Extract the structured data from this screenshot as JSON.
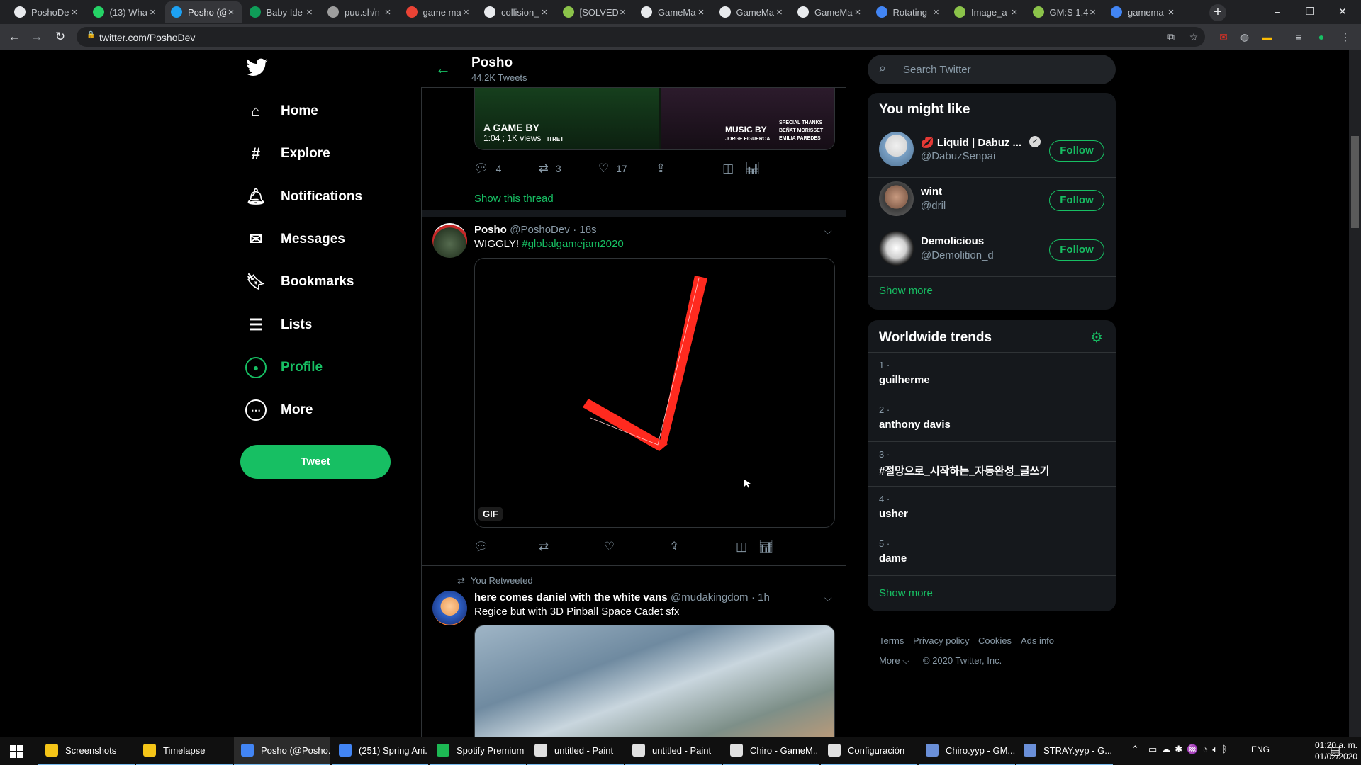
{
  "browser": {
    "tabs": [
      {
        "title": "PoshoDe",
        "favicon_color": "#e8eaed"
      },
      {
        "title": "(13) Wha",
        "favicon_color": "#25d366"
      },
      {
        "title": "Posho (@",
        "favicon_color": "#1da1f2"
      },
      {
        "title": "Baby Ide",
        "favicon_color": "#0f9d58"
      },
      {
        "title": "puu.sh/n",
        "favicon_color": "#9e9e9e"
      },
      {
        "title": "game ma",
        "favicon_color": "#ea4335"
      },
      {
        "title": "collision_",
        "favicon_color": "#e8eaed"
      },
      {
        "title": "[SOLVED",
        "favicon_color": "#8bc34a"
      },
      {
        "title": "GameMa",
        "favicon_color": "#e8eaed"
      },
      {
        "title": "GameMa",
        "favicon_color": "#e8eaed"
      },
      {
        "title": "GameMa",
        "favicon_color": "#e8eaed"
      },
      {
        "title": "Rotating",
        "favicon_color": "#4285f4"
      },
      {
        "title": "Image_a",
        "favicon_color": "#8bc34a"
      },
      {
        "title": "GM:S 1.4",
        "favicon_color": "#8bc34a"
      },
      {
        "title": "gamema",
        "favicon_color": "#4285f4"
      }
    ],
    "active_tab_index": 2,
    "url": "twitter.com/PoshoDev",
    "window_controls": {
      "minimize": "–",
      "restore": "❐",
      "close": "✕"
    }
  },
  "nav": {
    "items": [
      {
        "label": "Home",
        "icon": "home-icon"
      },
      {
        "label": "Explore",
        "icon": "hashtag-icon"
      },
      {
        "label": "Notifications",
        "icon": "bell-icon"
      },
      {
        "label": "Messages",
        "icon": "envelope-icon"
      },
      {
        "label": "Bookmarks",
        "icon": "bookmark-icon"
      },
      {
        "label": "Lists",
        "icon": "list-icon"
      },
      {
        "label": "Profile",
        "icon": "avatar-icon"
      },
      {
        "label": "More",
        "icon": "more-icon"
      }
    ],
    "active": "Profile",
    "tweet_button": "Tweet"
  },
  "header": {
    "name": "Posho",
    "tweet_count": "44.2K Tweets"
  },
  "previous_tweet": {
    "media_left_text": "A GAME BY",
    "media_overlay": "1:04 ; 1K views",
    "media_right_text": "MUSIC BY",
    "media_right_name": "JORGE FIGUEROA",
    "media_thanks": "SPECIAL THANKS",
    "media_thanks_1": "BEÑAT MORISSET",
    "media_thanks_2": "EMILIA PAREDES",
    "media_left_credit": "ITRET",
    "replies": "4",
    "retweets": "3",
    "likes": "17",
    "show_thread": "Show this thread"
  },
  "tweet": {
    "name": "Posho",
    "handle": "@PoshoDev",
    "time": "· 18s",
    "text": "WIGGLY!",
    "hashtag": "#globalgamejam2020",
    "media_badge": "GIF",
    "stroke_color": "#ff2a1f"
  },
  "retweet": {
    "context": "You Retweeted",
    "name": "here comes daniel with the white vans",
    "handle": "@mudakingdom",
    "time": "· 1h",
    "text": "Regice but with 3D Pinball Space Cadet sfx"
  },
  "search": {
    "placeholder": "Search Twitter"
  },
  "who_to_follow": {
    "title": "You might like",
    "users": [
      {
        "name": "💋 Liquid | Dabuz ...",
        "handle": "@DabuzSenpai",
        "verified": true,
        "button": "Follow"
      },
      {
        "name": "wint",
        "handle": "@dril",
        "verified": false,
        "button": "Follow"
      },
      {
        "name": "Demolicious",
        "handle": "@Demolition_d",
        "verified": false,
        "button": "Follow"
      }
    ],
    "show_more": "Show more"
  },
  "trends": {
    "title": "Worldwide trends",
    "items": [
      {
        "rank": "1 ·",
        "name": "guilherme"
      },
      {
        "rank": "2 ·",
        "name": "anthony davis"
      },
      {
        "rank": "3 ·",
        "name": "#절망으로_시작하는_자동완성_글쓰기"
      },
      {
        "rank": "4 ·",
        "name": "usher"
      },
      {
        "rank": "5 ·",
        "name": "dame"
      }
    ],
    "show_more": "Show more"
  },
  "footer": {
    "links": [
      "Terms",
      "Privacy policy",
      "Cookies",
      "Ads info"
    ],
    "more": "More ⌵",
    "copyright": "© 2020 Twitter, Inc."
  },
  "taskbar": {
    "items": [
      {
        "label": "Screenshots",
        "color": "#f5c518"
      },
      {
        "label": "Timelapse",
        "color": "#f5c518"
      },
      {
        "label": "Posho (@Posho...",
        "color": "#4285f4"
      },
      {
        "label": "(251) Spring Ani...",
        "color": "#4285f4"
      },
      {
        "label": "Spotify Premium",
        "color": "#1db954"
      },
      {
        "label": "untitled - Paint",
        "color": "#e0e0e0"
      },
      {
        "label": "untitled - Paint",
        "color": "#e0e0e0"
      },
      {
        "label": "Chiro - GameM...",
        "color": "#e0e0e0"
      },
      {
        "label": "Configuración",
        "color": "#e0e0e0"
      },
      {
        "label": "Chiro.yyp - GM...",
        "color": "#6a8fd8"
      },
      {
        "label": "STRAY.yyp - G...",
        "color": "#6a8fd8"
      }
    ],
    "language": "ENG",
    "time": "01:20 a. m.",
    "date": "01/02/2020"
  },
  "colors": {
    "accent": "#17bf63",
    "background": "#000000",
    "card": "#15181c"
  }
}
